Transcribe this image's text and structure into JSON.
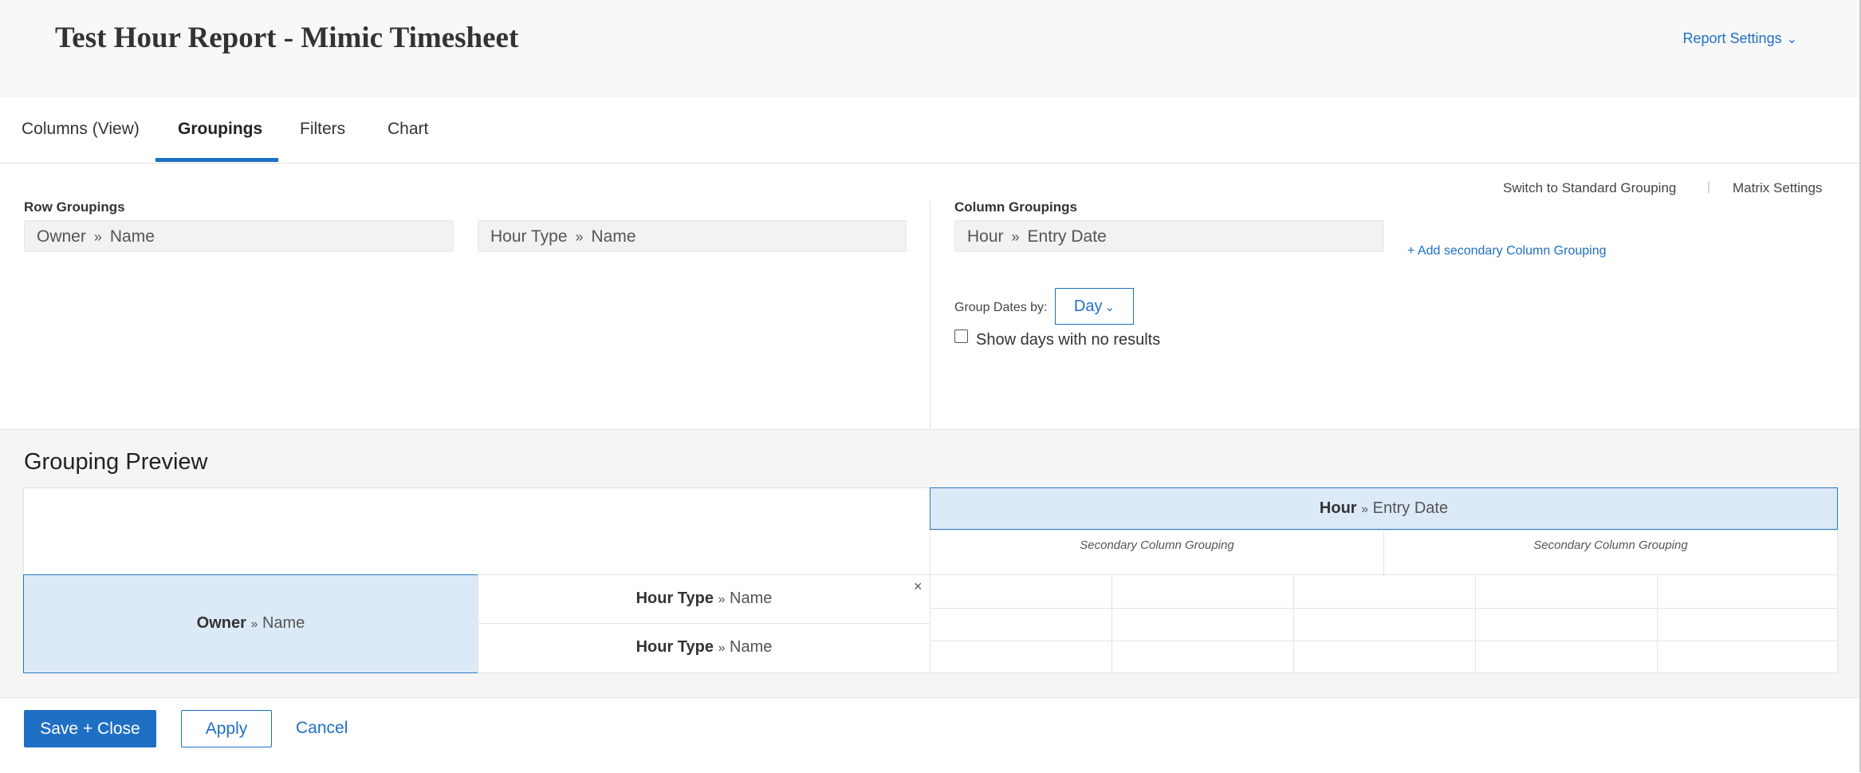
{
  "header": {
    "title": "Test Hour Report - Mimic Timesheet",
    "settings_label": "Report Settings",
    "settings_icon": "chevron-down-icon"
  },
  "tabs": [
    {
      "label": "Columns (View)",
      "active": false
    },
    {
      "label": "Groupings",
      "active": true
    },
    {
      "label": "Filters",
      "active": false
    },
    {
      "label": "Chart",
      "active": false
    }
  ],
  "row_groupings": {
    "label": "Row Groupings",
    "items": [
      {
        "field": "Owner",
        "sep": "»",
        "sub": "Name"
      },
      {
        "field": "Hour Type",
        "sep": "»",
        "sub": "Name"
      }
    ]
  },
  "column_groupings": {
    "label": "Column Groupings",
    "item": {
      "field": "Hour",
      "sep": "»",
      "sub": "Entry Date"
    },
    "add_secondary": "+ Add secondary Column Grouping",
    "switch_standard": "Switch to Standard Grouping",
    "pipe": "|",
    "matrix_settings": "Matrix Settings",
    "group_dates_label": "Group Dates by:",
    "group_dates_value": "Day",
    "show_days_label": "Show days with no results",
    "show_days_checked": false
  },
  "preview": {
    "title": "Grouping Preview",
    "col_header": {
      "field": "Hour",
      "sep": "»",
      "sub": "Entry Date"
    },
    "secondary_label": "Secondary Column Grouping",
    "row_header": {
      "field": "Owner",
      "sep": "»",
      "sub": "Name"
    },
    "sub_rows": [
      {
        "field": "Hour Type",
        "sep": "»",
        "sub": "Name"
      },
      {
        "field": "Hour Type",
        "sep": "»",
        "sub": "Name"
      }
    ],
    "close_glyph": "×"
  },
  "footer": {
    "save_close": "Save + Close",
    "apply": "Apply",
    "cancel": "Cancel"
  },
  "colors": {
    "accent": "#1f6fc5",
    "highlight": "#dce9f7"
  }
}
